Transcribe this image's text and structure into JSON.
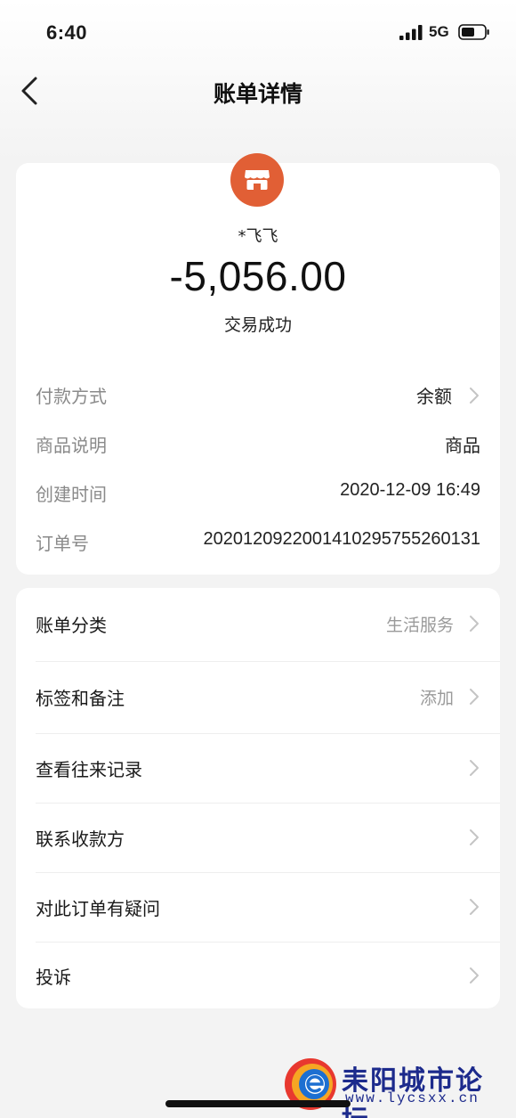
{
  "status_bar": {
    "time": "6:40",
    "network": "5G",
    "icons": [
      "signal-icon",
      "battery-icon"
    ]
  },
  "nav": {
    "title": "账单详情",
    "back_icon": "chevron-left-icon"
  },
  "transaction": {
    "merchant_icon": "shop-icon",
    "merchant_color": "#e15f35",
    "merchant_name": "*飞飞",
    "amount": "-5,056.00",
    "status": "交易成功"
  },
  "details": [
    {
      "label": "付款方式",
      "value": "余额"
    },
    {
      "label": "商品说明",
      "value": "商品"
    },
    {
      "label": "创建时间",
      "value": "2020-12-09 16:49"
    },
    {
      "label": "订单号",
      "value": "2020120922001410295755260131"
    }
  ],
  "menu": [
    {
      "label": "账单分类",
      "value": "生活服务"
    },
    {
      "label": "标签和备注",
      "value": "添加"
    },
    {
      "label": "查看往来记录",
      "value": ""
    },
    {
      "label": "联系收款方",
      "value": ""
    },
    {
      "label": "对此订单有疑问",
      "value": ""
    },
    {
      "label": "投诉",
      "value": ""
    }
  ],
  "watermark": {
    "title": "耒阳城市论坛",
    "url": "www.lycsxx.cn"
  }
}
